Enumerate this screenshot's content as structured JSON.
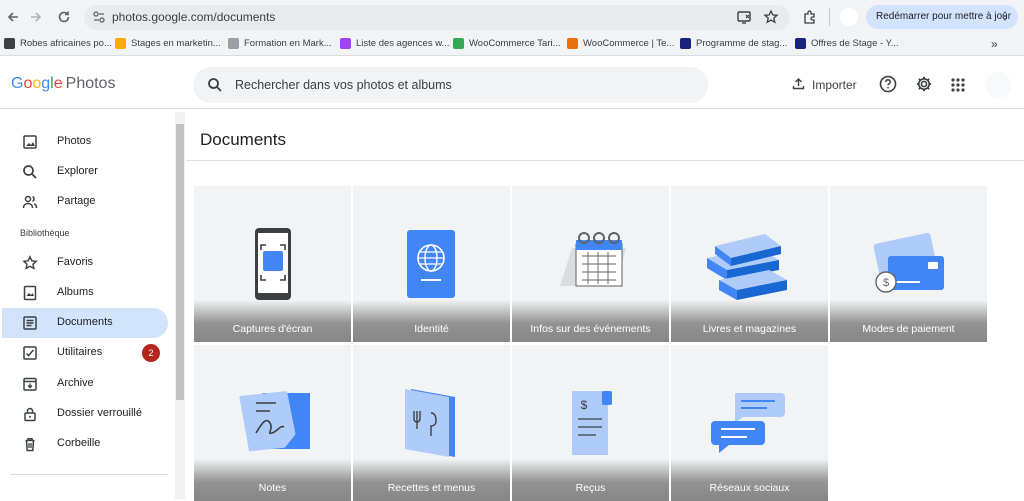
{
  "browser": {
    "url": "photos.google.com/documents",
    "restart_label": "Redémarrer pour mettre à jour",
    "bookmarks": [
      {
        "label": "Robes africaines po...",
        "color": "#3c4043"
      },
      {
        "label": "Stages en marketin...",
        "color": "#f9ab00"
      },
      {
        "label": "Formation en Mark...",
        "color": "#9aa0a6"
      },
      {
        "label": "Liste des agences w...",
        "color": "#a142f4"
      },
      {
        "label": "WooCommerce Tari...",
        "color": "#34a853"
      },
      {
        "label": "WooCommerce | Te...",
        "color": "#e8710a"
      },
      {
        "label": "Programme de stag...",
        "color": "#1a237e"
      },
      {
        "label": "Offres de Stage - Y...",
        "color": "#1a237e"
      }
    ]
  },
  "header": {
    "logo_parts": [
      "G",
      "o",
      "o",
      "g",
      "l",
      "e"
    ],
    "logo_product": "Photos",
    "search_placeholder": "Rechercher dans vos photos et albums",
    "import_label": "Importer"
  },
  "sidebar": {
    "section_label": "Bibliothèque",
    "items": [
      {
        "label": "Photos",
        "icon": "photo-icon"
      },
      {
        "label": "Explorer",
        "icon": "search-icon"
      },
      {
        "label": "Partage",
        "icon": "people-icon"
      },
      {
        "label": "Favoris",
        "icon": "star-icon"
      },
      {
        "label": "Albums",
        "icon": "album-icon"
      },
      {
        "label": "Documents",
        "icon": "document-icon",
        "active": true
      },
      {
        "label": "Utilitaires",
        "icon": "utilities-icon",
        "badge": "2"
      },
      {
        "label": "Archive",
        "icon": "archive-icon"
      },
      {
        "label": "Dossier verrouillé",
        "icon": "lock-icon"
      },
      {
        "label": "Corbeille",
        "icon": "trash-icon"
      }
    ]
  },
  "main": {
    "title": "Documents",
    "categories": [
      {
        "label": "Captures d'écran",
        "icon": "phone-screenshot-icon"
      },
      {
        "label": "Identité",
        "icon": "passport-icon"
      },
      {
        "label": "Infos sur des événements",
        "icon": "calendar-icon"
      },
      {
        "label": "Livres et magazines",
        "icon": "books-icon"
      },
      {
        "label": "Modes de paiement",
        "icon": "credit-card-icon"
      },
      {
        "label": "Notes",
        "icon": "note-icon"
      },
      {
        "label": "Recettes et menus",
        "icon": "menu-icon"
      },
      {
        "label": "Reçus",
        "icon": "receipt-icon"
      },
      {
        "label": "Réseaux sociaux",
        "icon": "chat-bubbles-icon"
      }
    ]
  },
  "colors": {
    "accent": "#4285f4",
    "active_bg": "#d2e3fc",
    "badge": "#b3261e"
  }
}
